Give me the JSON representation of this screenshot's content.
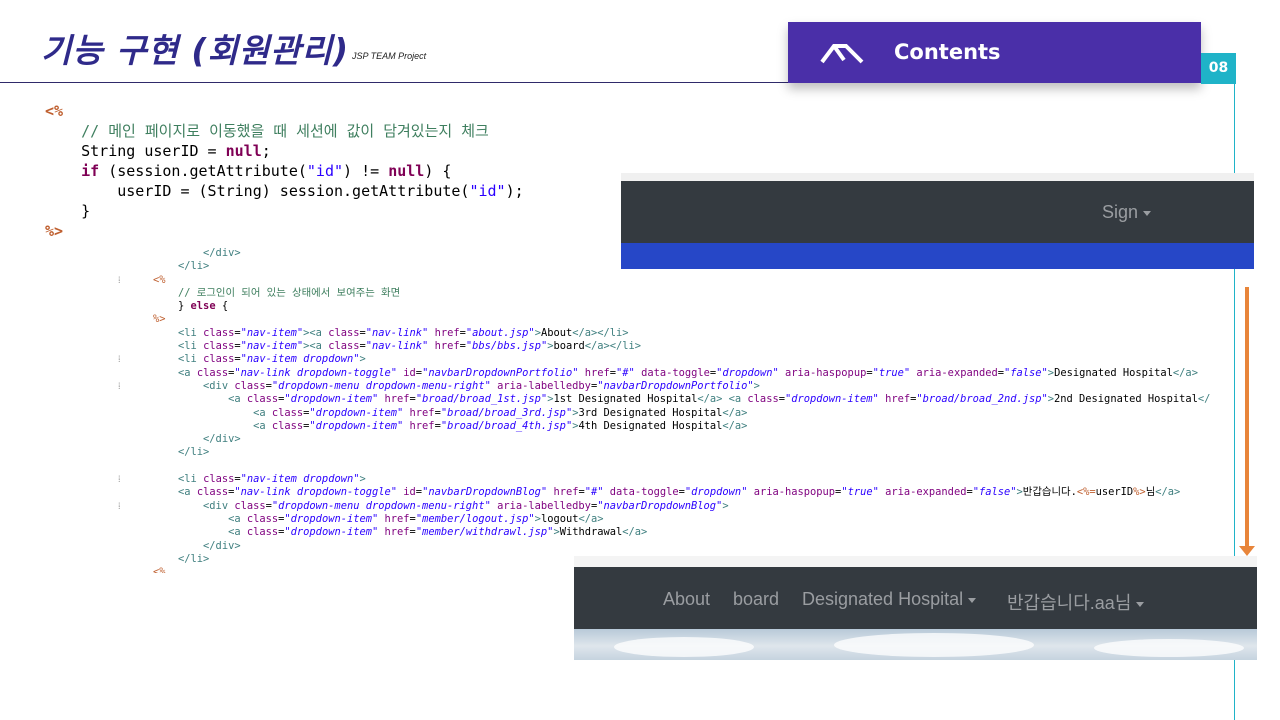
{
  "slide": {
    "title": "기능 구현 (회원관리)",
    "subtitle": "JSP TEAM  Project",
    "contents_label": "Contents",
    "page_number": "08"
  },
  "code_top": [
    [
      {
        "c": "tag",
        "t": "<%"
      }
    ],
    [
      {
        "c": "",
        "t": "    "
      },
      {
        "c": "cm",
        "t": "// 메인 페이지로 이동했을 때 세션에 값이 담겨있는지 체크"
      }
    ],
    [
      {
        "c": "",
        "t": "    String userID = "
      },
      {
        "c": "kw",
        "t": "null"
      },
      {
        "c": "",
        "t": ";"
      }
    ],
    [
      {
        "c": "",
        "t": "    "
      },
      {
        "c": "kw",
        "t": "if"
      },
      {
        "c": "",
        "t": " (session.getAttribute("
      },
      {
        "c": "str",
        "t": "\"id\""
      },
      {
        "c": "",
        "t": ") != "
      },
      {
        "c": "kw",
        "t": "null"
      },
      {
        "c": "",
        "t": ") {"
      }
    ],
    [
      {
        "c": "",
        "t": "        userID = (String) session.getAttribute("
      },
      {
        "c": "str",
        "t": "\"id\""
      },
      {
        "c": "",
        "t": ");"
      }
    ],
    [
      {
        "c": "",
        "t": "    }"
      }
    ],
    [
      {
        "c": "tag",
        "t": "%>"
      }
    ]
  ],
  "code_bottom": [
    {
      "g": "",
      "s": [
        {
          "c": "",
          "t": "        "
        },
        {
          "c": "tagn",
          "t": "</div>"
        }
      ]
    },
    {
      "g": "",
      "s": [
        {
          "c": "",
          "t": "    "
        },
        {
          "c": "tagn",
          "t": "</li>"
        }
      ]
    },
    {
      "g": "⁞ ",
      "s": [
        {
          "c": "jsp",
          "t": "<%"
        }
      ]
    },
    {
      "g": "",
      "s": [
        {
          "c": "",
          "t": "    "
        },
        {
          "c": "cm",
          "t": "// 로그인이 되어 있는 상태에서 보여주는 화면"
        }
      ]
    },
    {
      "g": "",
      "s": [
        {
          "c": "",
          "t": "    } "
        },
        {
          "c": "kw",
          "t": "else"
        },
        {
          "c": "",
          "t": " {"
        }
      ]
    },
    {
      "g": "",
      "s": [
        {
          "c": "jsp",
          "t": "%>"
        }
      ]
    },
    {
      "g": "",
      "s": [
        {
          "c": "",
          "t": "    "
        },
        {
          "c": "tagn",
          "t": "<li "
        },
        {
          "c": "an",
          "t": "class"
        },
        {
          "c": "",
          "t": "="
        },
        {
          "c": "av",
          "t": "\"nav-item\""
        },
        {
          "c": "tagn",
          "t": "><a "
        },
        {
          "c": "an",
          "t": "class"
        },
        {
          "c": "",
          "t": "="
        },
        {
          "c": "av",
          "t": "\"nav-link\""
        },
        {
          "c": "",
          "t": " "
        },
        {
          "c": "an",
          "t": "href"
        },
        {
          "c": "",
          "t": "="
        },
        {
          "c": "av",
          "t": "\"about.jsp\""
        },
        {
          "c": "tagn",
          "t": ">"
        },
        {
          "c": "",
          "t": "About"
        },
        {
          "c": "tagn",
          "t": "</a></li>"
        }
      ]
    },
    {
      "g": "",
      "s": [
        {
          "c": "",
          "t": "    "
        },
        {
          "c": "tagn",
          "t": "<li "
        },
        {
          "c": "an",
          "t": "class"
        },
        {
          "c": "",
          "t": "="
        },
        {
          "c": "av",
          "t": "\"nav-item\""
        },
        {
          "c": "tagn",
          "t": "><a "
        },
        {
          "c": "an",
          "t": "class"
        },
        {
          "c": "",
          "t": "="
        },
        {
          "c": "av",
          "t": "\"nav-link\""
        },
        {
          "c": "",
          "t": " "
        },
        {
          "c": "an",
          "t": "href"
        },
        {
          "c": "",
          "t": "="
        },
        {
          "c": "av",
          "t": "\"bbs/bbs.jsp\""
        },
        {
          "c": "tagn",
          "t": ">"
        },
        {
          "c": "",
          "t": "board"
        },
        {
          "c": "tagn",
          "t": "</a></li>"
        }
      ]
    },
    {
      "g": "⁞",
      "s": [
        {
          "c": "",
          "t": "    "
        },
        {
          "c": "tagn",
          "t": "<li "
        },
        {
          "c": "an",
          "t": "class"
        },
        {
          "c": "",
          "t": "="
        },
        {
          "c": "av",
          "t": "\"nav-item dropdown\""
        },
        {
          "c": "tagn",
          "t": ">"
        }
      ]
    },
    {
      "g": "",
      "s": [
        {
          "c": "",
          "t": "    "
        },
        {
          "c": "tagn",
          "t": "<a "
        },
        {
          "c": "an",
          "t": "class"
        },
        {
          "c": "",
          "t": "="
        },
        {
          "c": "av",
          "t": "\"nav-link dropdown-toggle\""
        },
        {
          "c": "",
          "t": " "
        },
        {
          "c": "an",
          "t": "id"
        },
        {
          "c": "",
          "t": "="
        },
        {
          "c": "av",
          "t": "\"navbarDropdownPortfolio\""
        },
        {
          "c": "",
          "t": " "
        },
        {
          "c": "an",
          "t": "href"
        },
        {
          "c": "",
          "t": "="
        },
        {
          "c": "av",
          "t": "\"#\""
        },
        {
          "c": "",
          "t": " "
        },
        {
          "c": "an",
          "t": "data-toggle"
        },
        {
          "c": "",
          "t": "="
        },
        {
          "c": "av",
          "t": "\"dropdown\""
        },
        {
          "c": "",
          "t": " "
        },
        {
          "c": "an",
          "t": "aria-haspopup"
        },
        {
          "c": "",
          "t": "="
        },
        {
          "c": "av",
          "t": "\"true\""
        },
        {
          "c": "",
          "t": " "
        },
        {
          "c": "an",
          "t": "aria-expanded"
        },
        {
          "c": "",
          "t": "="
        },
        {
          "c": "av",
          "t": "\"false\""
        },
        {
          "c": "tagn",
          "t": ">"
        },
        {
          "c": "",
          "t": "Designated Hospital"
        },
        {
          "c": "tagn",
          "t": "</a>"
        }
      ]
    },
    {
      "g": "⁞",
      "s": [
        {
          "c": "",
          "t": "        "
        },
        {
          "c": "tagn",
          "t": "<div "
        },
        {
          "c": "an",
          "t": "class"
        },
        {
          "c": "",
          "t": "="
        },
        {
          "c": "av",
          "t": "\"dropdown-menu dropdown-menu-right\""
        },
        {
          "c": "",
          "t": " "
        },
        {
          "c": "an",
          "t": "aria-labelledby"
        },
        {
          "c": "",
          "t": "="
        },
        {
          "c": "av",
          "t": "\"navbarDropdownPortfolio\""
        },
        {
          "c": "tagn",
          "t": ">"
        }
      ]
    },
    {
      "g": "",
      "s": [
        {
          "c": "",
          "t": "            "
        },
        {
          "c": "tagn",
          "t": "<a "
        },
        {
          "c": "an",
          "t": "class"
        },
        {
          "c": "",
          "t": "="
        },
        {
          "c": "av",
          "t": "\"dropdown-item\""
        },
        {
          "c": "",
          "t": " "
        },
        {
          "c": "an",
          "t": "href"
        },
        {
          "c": "",
          "t": "="
        },
        {
          "c": "av",
          "t": "\"broad/broad_1st.jsp\""
        },
        {
          "c": "tagn",
          "t": ">"
        },
        {
          "c": "",
          "t": "1st Designated Hospital"
        },
        {
          "c": "tagn",
          "t": "</a>"
        },
        {
          "c": "",
          "t": " "
        },
        {
          "c": "tagn",
          "t": "<a "
        },
        {
          "c": "an",
          "t": "class"
        },
        {
          "c": "",
          "t": "="
        },
        {
          "c": "av",
          "t": "\"dropdown-item\""
        },
        {
          "c": "",
          "t": " "
        },
        {
          "c": "an",
          "t": "href"
        },
        {
          "c": "",
          "t": "="
        },
        {
          "c": "av",
          "t": "\"broad/broad_2nd.jsp\""
        },
        {
          "c": "tagn",
          "t": ">"
        },
        {
          "c": "",
          "t": "2nd Designated Hospital"
        },
        {
          "c": "tagn",
          "t": "</"
        }
      ]
    },
    {
      "g": "",
      "s": [
        {
          "c": "",
          "t": "                "
        },
        {
          "c": "tagn",
          "t": "<a "
        },
        {
          "c": "an",
          "t": "class"
        },
        {
          "c": "",
          "t": "="
        },
        {
          "c": "av",
          "t": "\"dropdown-item\""
        },
        {
          "c": "",
          "t": " "
        },
        {
          "c": "an",
          "t": "href"
        },
        {
          "c": "",
          "t": "="
        },
        {
          "c": "av",
          "t": "\"broad/broad_3rd.jsp\""
        },
        {
          "c": "tagn",
          "t": ">"
        },
        {
          "c": "",
          "t": "3rd Designated Hospital"
        },
        {
          "c": "tagn",
          "t": "</a>"
        }
      ]
    },
    {
      "g": "",
      "s": [
        {
          "c": "",
          "t": "                "
        },
        {
          "c": "tagn",
          "t": "<a "
        },
        {
          "c": "an",
          "t": "class"
        },
        {
          "c": "",
          "t": "="
        },
        {
          "c": "av",
          "t": "\"dropdown-item\""
        },
        {
          "c": "",
          "t": " "
        },
        {
          "c": "an",
          "t": "href"
        },
        {
          "c": "",
          "t": "="
        },
        {
          "c": "av",
          "t": "\"broad/broad_4th.jsp\""
        },
        {
          "c": "tagn",
          "t": ">"
        },
        {
          "c": "",
          "t": "4th Designated Hospital"
        },
        {
          "c": "tagn",
          "t": "</a>"
        }
      ]
    },
    {
      "g": "",
      "s": [
        {
          "c": "",
          "t": "        "
        },
        {
          "c": "tagn",
          "t": "</div>"
        }
      ]
    },
    {
      "g": "",
      "s": [
        {
          "c": "",
          "t": "    "
        },
        {
          "c": "tagn",
          "t": "</li>"
        }
      ]
    },
    {
      "g": "",
      "s": [
        {
          "c": "",
          "t": ""
        }
      ]
    },
    {
      "g": "⁞",
      "s": [
        {
          "c": "",
          "t": "    "
        },
        {
          "c": "tagn",
          "t": "<li "
        },
        {
          "c": "an",
          "t": "class"
        },
        {
          "c": "",
          "t": "="
        },
        {
          "c": "av",
          "t": "\"nav-item dropdown\""
        },
        {
          "c": "tagn",
          "t": ">"
        }
      ]
    },
    {
      "g": "",
      "s": [
        {
          "c": "",
          "t": "    "
        },
        {
          "c": "tagn",
          "t": "<a "
        },
        {
          "c": "an",
          "t": "class"
        },
        {
          "c": "",
          "t": "="
        },
        {
          "c": "av",
          "t": "\"nav-link dropdown-toggle\""
        },
        {
          "c": "",
          "t": " "
        },
        {
          "c": "an",
          "t": "id"
        },
        {
          "c": "",
          "t": "="
        },
        {
          "c": "av",
          "t": "\"navbarDropdownBlog\""
        },
        {
          "c": "",
          "t": " "
        },
        {
          "c": "an",
          "t": "href"
        },
        {
          "c": "",
          "t": "="
        },
        {
          "c": "av",
          "t": "\"#\""
        },
        {
          "c": "",
          "t": " "
        },
        {
          "c": "an",
          "t": "data-toggle"
        },
        {
          "c": "",
          "t": "="
        },
        {
          "c": "av",
          "t": "\"dropdown\""
        },
        {
          "c": "",
          "t": " "
        },
        {
          "c": "an",
          "t": "aria-haspopup"
        },
        {
          "c": "",
          "t": "="
        },
        {
          "c": "av",
          "t": "\"true\""
        },
        {
          "c": "",
          "t": " "
        },
        {
          "c": "an",
          "t": "aria-expanded"
        },
        {
          "c": "",
          "t": "="
        },
        {
          "c": "av",
          "t": "\"false\""
        },
        {
          "c": "tagn",
          "t": ">"
        },
        {
          "c": "",
          "t": "반갑습니다."
        },
        {
          "c": "jsp",
          "t": "<%="
        },
        {
          "c": "",
          "t": "userID"
        },
        {
          "c": "jsp",
          "t": "%>"
        },
        {
          "c": "",
          "t": "님"
        },
        {
          "c": "tagn",
          "t": "</a>"
        }
      ]
    },
    {
      "g": "⁞",
      "s": [
        {
          "c": "",
          "t": "        "
        },
        {
          "c": "tagn",
          "t": "<div "
        },
        {
          "c": "an",
          "t": "class"
        },
        {
          "c": "",
          "t": "="
        },
        {
          "c": "av",
          "t": "\"dropdown-menu dropdown-menu-right\""
        },
        {
          "c": "",
          "t": " "
        },
        {
          "c": "an",
          "t": "aria-labelledby"
        },
        {
          "c": "",
          "t": "="
        },
        {
          "c": "av",
          "t": "\"navbarDropdownBlog\""
        },
        {
          "c": "tagn",
          "t": ">"
        }
      ]
    },
    {
      "g": "",
      "s": [
        {
          "c": "",
          "t": "            "
        },
        {
          "c": "tagn",
          "t": "<a "
        },
        {
          "c": "an",
          "t": "class"
        },
        {
          "c": "",
          "t": "="
        },
        {
          "c": "av",
          "t": "\"dropdown-item\""
        },
        {
          "c": "",
          "t": " "
        },
        {
          "c": "an",
          "t": "href"
        },
        {
          "c": "",
          "t": "="
        },
        {
          "c": "av",
          "t": "\"member/logout.jsp\""
        },
        {
          "c": "tagn",
          "t": ">"
        },
        {
          "c": "",
          "t": "logout"
        },
        {
          "c": "tagn",
          "t": "</a>"
        }
      ]
    },
    {
      "g": "",
      "s": [
        {
          "c": "",
          "t": "            "
        },
        {
          "c": "tagn",
          "t": "<a "
        },
        {
          "c": "an",
          "t": "class"
        },
        {
          "c": "",
          "t": "="
        },
        {
          "c": "av",
          "t": "\"dropdown-item\""
        },
        {
          "c": "",
          "t": " "
        },
        {
          "c": "an",
          "t": "href"
        },
        {
          "c": "",
          "t": "="
        },
        {
          "c": "av",
          "t": "\"member/withdrawl.jsp\""
        },
        {
          "c": "tagn",
          "t": ">"
        },
        {
          "c": "",
          "t": "Withdrawal"
        },
        {
          "c": "tagn",
          "t": "</a>"
        }
      ]
    },
    {
      "g": "",
      "s": [
        {
          "c": "",
          "t": "        "
        },
        {
          "c": "tagn",
          "t": "</div>"
        }
      ]
    },
    {
      "g": "",
      "s": [
        {
          "c": "",
          "t": "    "
        },
        {
          "c": "tagn",
          "t": "</li>"
        }
      ]
    },
    {
      "g": "",
      "s": [
        {
          "c": "jsp",
          "t": "<%"
        }
      ]
    }
  ],
  "screenshot_logged_out": {
    "sign_label": "Sign"
  },
  "screenshot_logged_in": {
    "nav_items": [
      "About",
      "board",
      "Designated Hospital",
      "반갑습니다.aa님"
    ]
  },
  "colors": {
    "title": "#2f2a8a",
    "contents_bar": "#4a2fa8",
    "page_badge": "#1fb3c8",
    "arrow": "#e8853a",
    "navbar": "#343a40",
    "jumbotron_blue": "#2647c7"
  },
  "icons": {
    "contents_icon": "home-roof-icon",
    "dropdown_icon": "caret-down-icon",
    "flow_arrow": "arrow-down-icon"
  }
}
